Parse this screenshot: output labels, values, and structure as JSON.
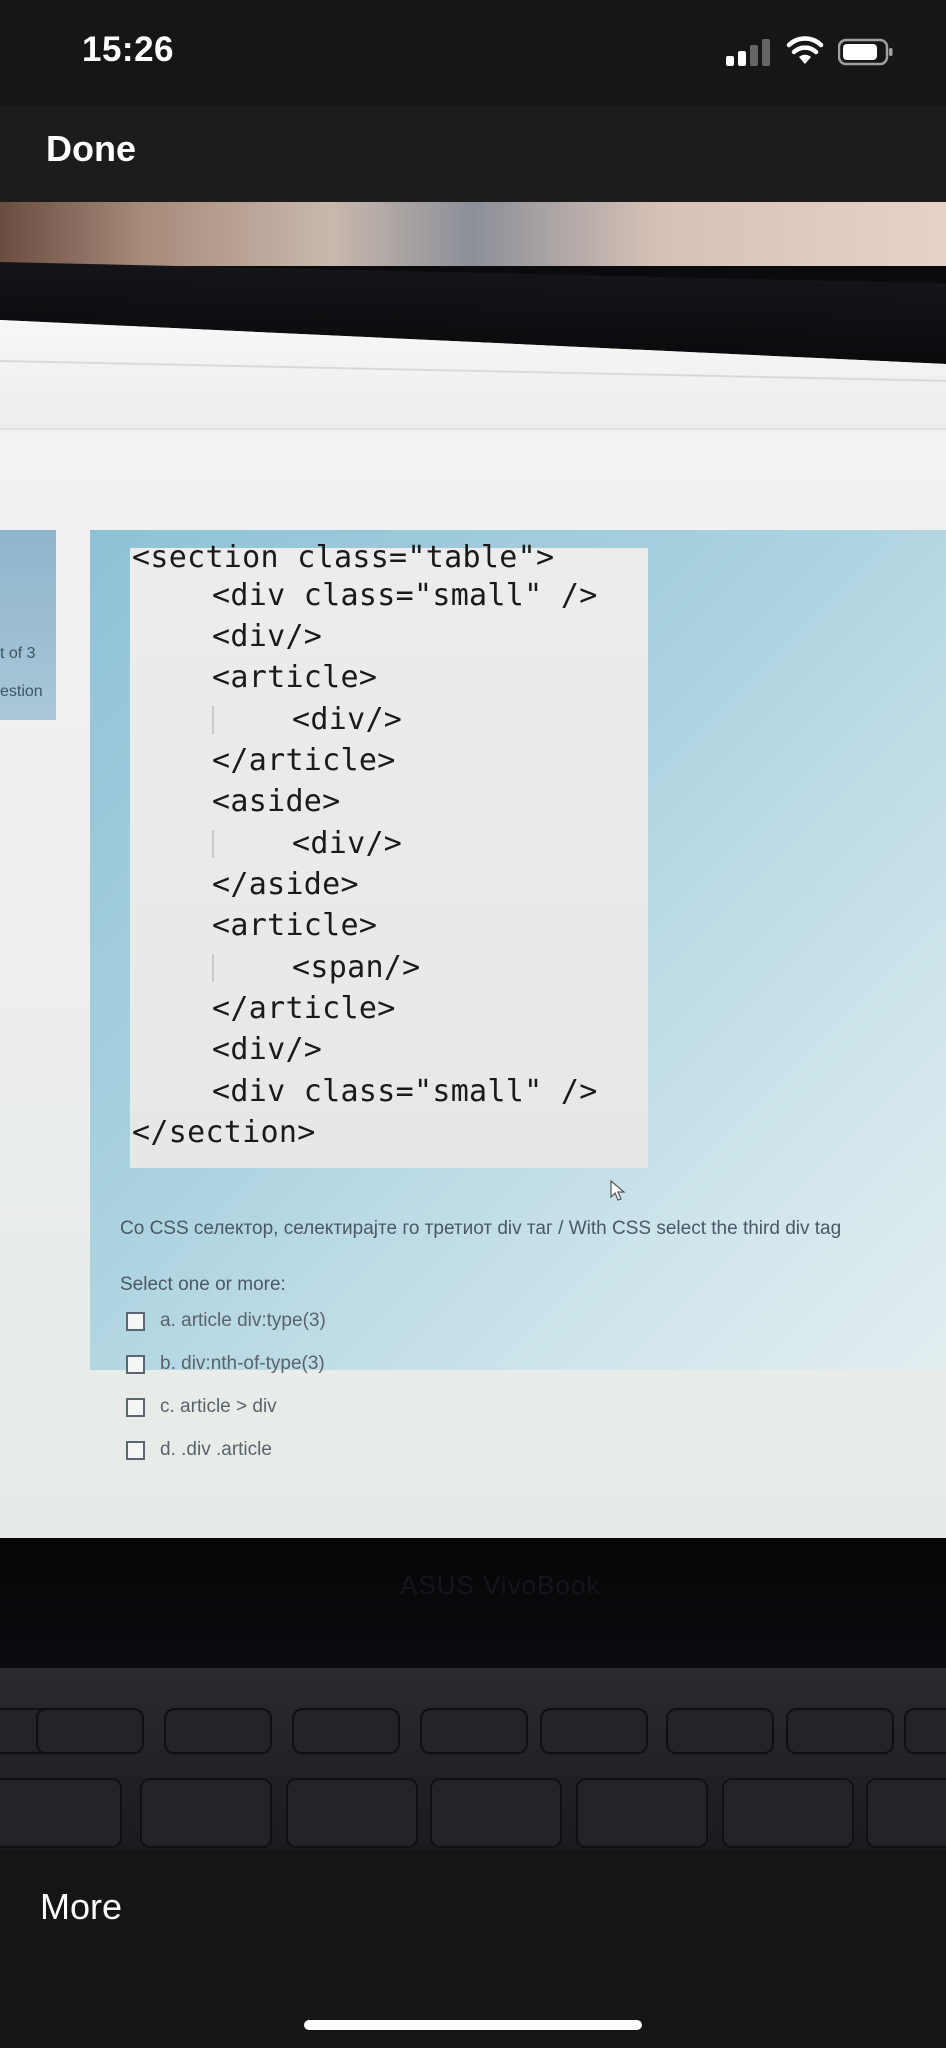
{
  "status_bar": {
    "time": "15:26",
    "icons": [
      "cellular-signal-icon",
      "wifi-icon",
      "battery-icon"
    ]
  },
  "top_bar": {
    "done_label": "Done"
  },
  "photo": {
    "sidebar_nav": {
      "line1": "t of 3",
      "line2": "estion"
    },
    "code_lines": [
      "<section class=\"table\">",
      "<div class=\"small\" />",
      "<div/>",
      "<article>",
      "<div/>",
      "</article>",
      "<aside>",
      "<div/>",
      "</aside>",
      "<article>",
      "<span/>",
      "</article>",
      "<div/>",
      "<div class=\"small\" />",
      "</section>"
    ],
    "question": "Со CSS селектор, селектирајте го третиот div таг / With CSS select the third div tag",
    "select_label": "Select one or more:",
    "options": [
      "a. article div:type(3)",
      "b. div:nth-of-type(3)",
      "c. article > div",
      "d. .div .article"
    ],
    "laptop_brand": "ASUS VivoBook"
  },
  "bottom_bar": {
    "more_label": "More"
  },
  "colors": {
    "ios_bar": "#161616",
    "panel_blue": "#8fc2d6",
    "code_bg": "#ececec"
  }
}
